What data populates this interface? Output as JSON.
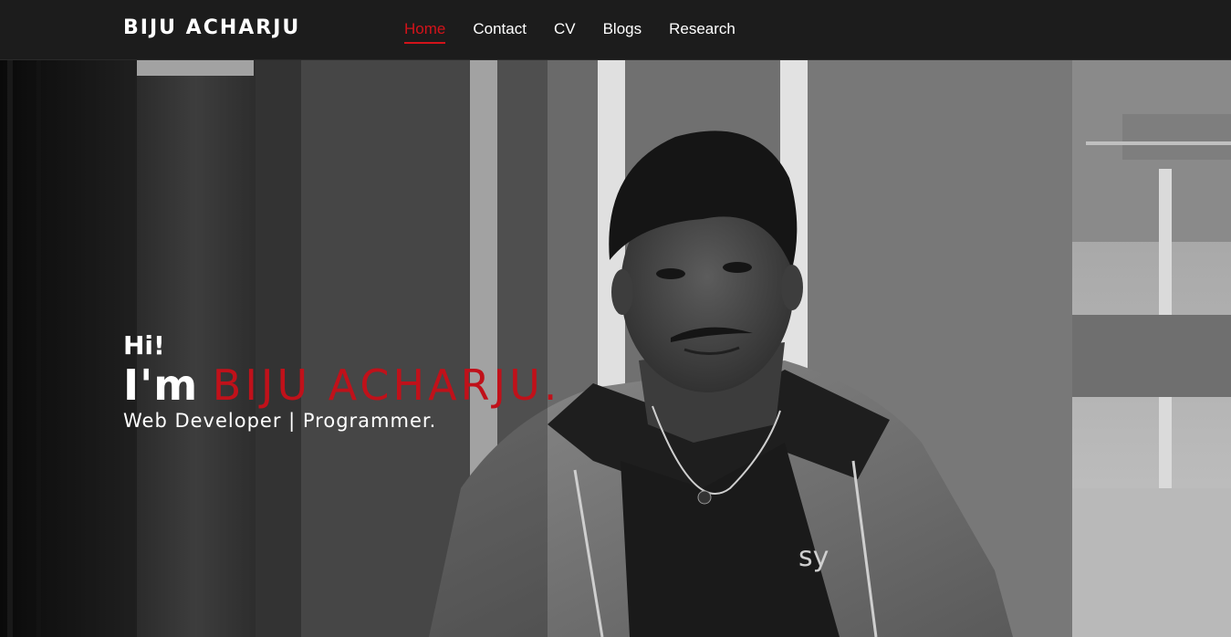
{
  "navbar": {
    "brand": "BIJU ACHARJU",
    "links": [
      {
        "label": "Home",
        "active": true
      },
      {
        "label": "Contact",
        "active": false
      },
      {
        "label": "CV",
        "active": false
      },
      {
        "label": "Blogs",
        "active": false
      },
      {
        "label": "Research",
        "active": false
      }
    ]
  },
  "hero": {
    "greeting": "Hi!",
    "intro_prefix": "I'm",
    "name": "BIJU ACHARJU.",
    "role": "Web Developer | Programmer.",
    "shirt_text": "sy"
  },
  "colors": {
    "accent": "#d3131a",
    "navbar_bg": "#1c1c1c",
    "text": "#ffffff"
  }
}
